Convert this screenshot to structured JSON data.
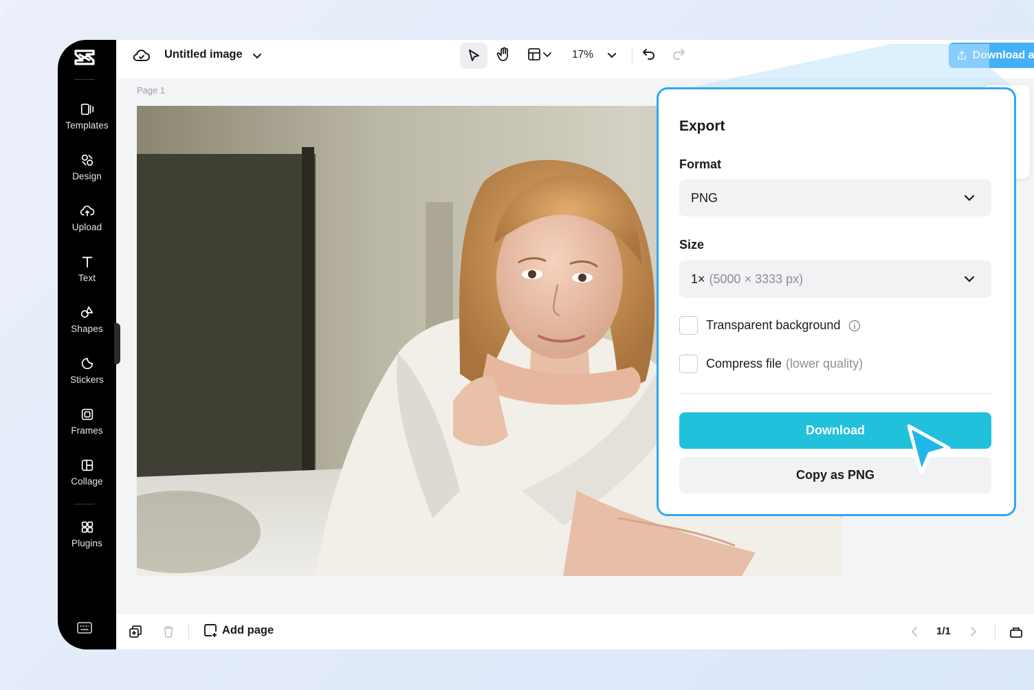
{
  "app": {
    "doc_title": "Untitled image",
    "zoom": "17%",
    "page_label": "Page 1"
  },
  "sidebar": {
    "items": [
      {
        "label": "Templates",
        "icon": "templates-icon"
      },
      {
        "label": "Design",
        "icon": "design-icon"
      },
      {
        "label": "Upload",
        "icon": "upload-icon"
      },
      {
        "label": "Text",
        "icon": "text-icon"
      },
      {
        "label": "Shapes",
        "icon": "shapes-icon"
      },
      {
        "label": "Stickers",
        "icon": "stickers-icon"
      },
      {
        "label": "Frames",
        "icon": "frames-icon"
      },
      {
        "label": "Collage",
        "icon": "collage-icon"
      },
      {
        "label": "Plugins",
        "icon": "plugins-icon"
      }
    ]
  },
  "toolbar": {
    "download_all": "Download all"
  },
  "export": {
    "title": "Export",
    "format_label": "Format",
    "format_value": "PNG",
    "size_label": "Size",
    "size_value": "1×",
    "size_detail": "(5000 × 3333 px)",
    "transparent_label": "Transparent background",
    "compress_label": "Compress file",
    "compress_note": "(lower quality)",
    "download_label": "Download",
    "copy_label": "Copy as PNG"
  },
  "bottombar": {
    "add_page": "Add page",
    "pager": "1/1"
  },
  "colors": {
    "accent": "#21c1db",
    "download_all_bg": "#43b0f8",
    "panel_border": "#2fa8ef",
    "sidebar_bg": "#000000"
  }
}
